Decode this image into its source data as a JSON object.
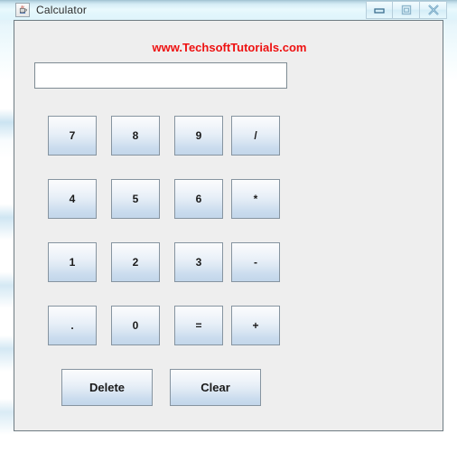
{
  "window": {
    "title": "Calculator",
    "app_icon": "java-coffee-cup-icon",
    "controls": [
      {
        "name": "minimize-button",
        "glyph": "minimize-icon",
        "label": "Minimize"
      },
      {
        "name": "maximize-button",
        "glyph": "maximize-icon",
        "label": "Maximize"
      },
      {
        "name": "close-button",
        "glyph": "close-icon",
        "label": "Close"
      }
    ]
  },
  "banner": {
    "text": "www.TechsoftTutorials.com",
    "color": "#ee1111"
  },
  "display": {
    "value": "",
    "placeholder": ""
  },
  "keypad": {
    "rows": [
      [
        {
          "name": "key-7",
          "label": "7"
        },
        {
          "name": "key-8",
          "label": "8"
        },
        {
          "name": "key-9",
          "label": "9"
        },
        {
          "name": "key-divide",
          "label": "/"
        }
      ],
      [
        {
          "name": "key-4",
          "label": "4"
        },
        {
          "name": "key-5",
          "label": "5"
        },
        {
          "name": "key-6",
          "label": "6"
        },
        {
          "name": "key-multiply",
          "label": "*"
        }
      ],
      [
        {
          "name": "key-1",
          "label": "1"
        },
        {
          "name": "key-2",
          "label": "2"
        },
        {
          "name": "key-3",
          "label": "3"
        },
        {
          "name": "key-minus",
          "label": "-"
        }
      ],
      [
        {
          "name": "key-decimal",
          "label": "."
        },
        {
          "name": "key-0",
          "label": "0"
        },
        {
          "name": "key-equals",
          "label": "="
        },
        {
          "name": "key-plus",
          "label": "+"
        }
      ]
    ]
  },
  "actions": [
    {
      "name": "delete-button",
      "label": "Delete"
    },
    {
      "name": "clear-button",
      "label": "Clear"
    }
  ],
  "colors": {
    "titlebar_glass": "#e2f6fc",
    "panel_background": "#eeeeee",
    "button_top": "#fbfcfd",
    "button_bottom": "#c3d6ea",
    "button_border": "#8694a0",
    "panel_border": "#6e7b82"
  }
}
